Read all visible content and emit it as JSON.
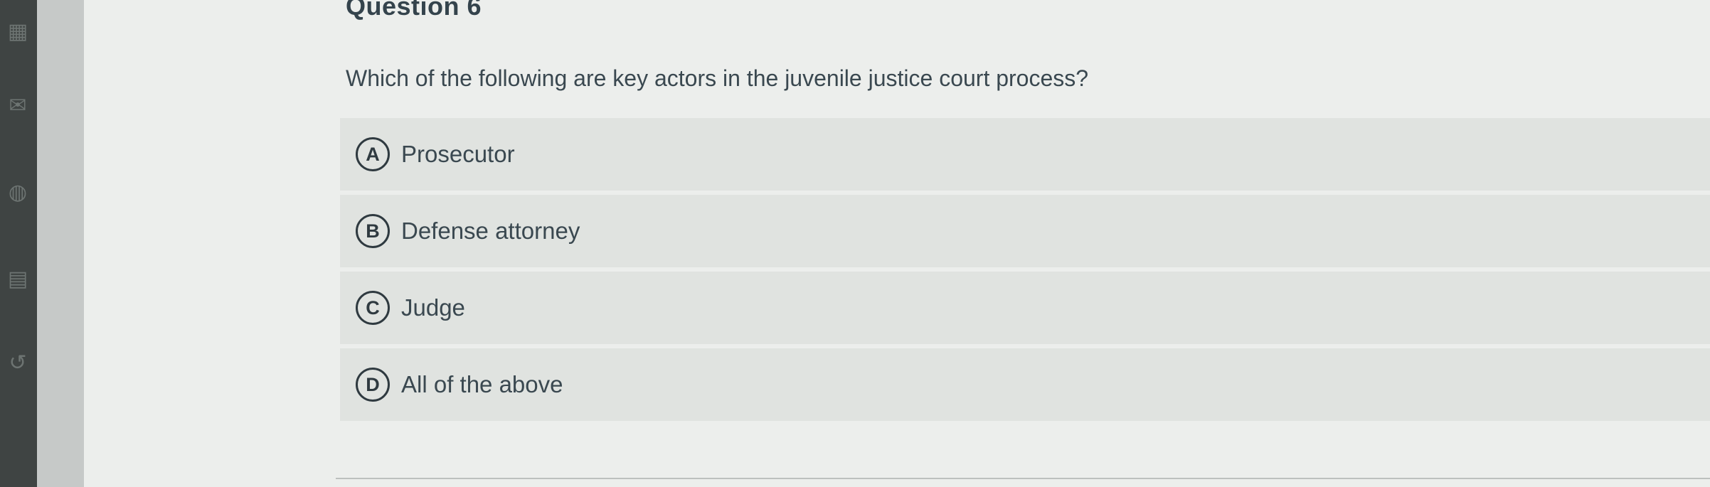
{
  "question": {
    "title": "Question 6",
    "prompt": "Which of the following are key actors in the juvenile justice court process?"
  },
  "answers": [
    {
      "letter": "A",
      "label": "Prosecutor"
    },
    {
      "letter": "B",
      "label": "Defense attorney"
    },
    {
      "letter": "C",
      "label": "Judge"
    },
    {
      "letter": "D",
      "label": "All of the above"
    }
  ],
  "sidebar": {
    "icons": [
      "calendar-icon",
      "inbox-icon",
      "globe-icon",
      "book-icon",
      "history-icon"
    ]
  },
  "colors": {
    "sidebar": "#3f4443",
    "gutter": "#c6c9c8",
    "content_bg": "#eceeec",
    "answer_bg": "#e0e3e0",
    "text": "#3a4850"
  }
}
